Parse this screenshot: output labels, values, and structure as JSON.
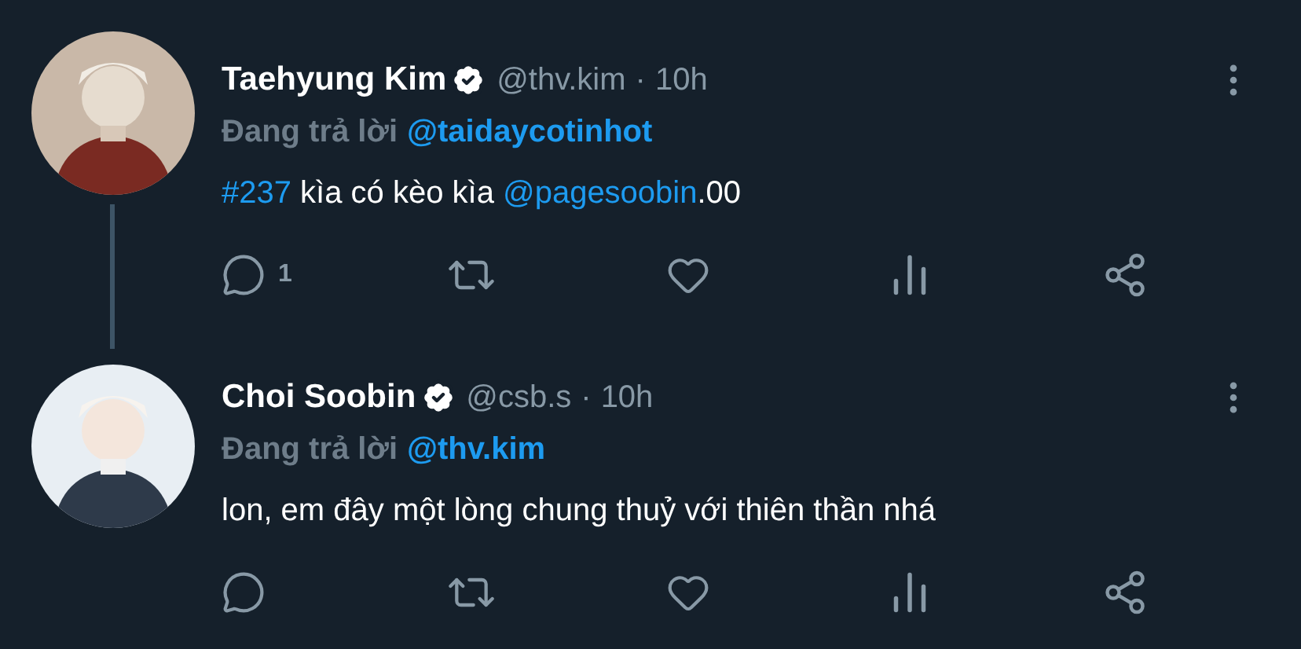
{
  "tweets": [
    {
      "name": "Taehyung Kim",
      "verified": true,
      "handle": "@thv.kim",
      "separator": "·",
      "time": "10h",
      "reply_label": "Đang trả lời",
      "reply_to": "@taidaycotinhot",
      "thread_line": true,
      "body": [
        {
          "kind": "hashtag",
          "text": "#237"
        },
        {
          "kind": "text",
          "text": " kìa có kèo kìa "
        },
        {
          "kind": "mention",
          "text": "@pagesoobin"
        },
        {
          "kind": "text",
          "text": ".00"
        }
      ],
      "reply_count": "1"
    },
    {
      "name": "Choi Soobin",
      "verified": true,
      "handle": "@csb.s",
      "separator": "·",
      "time": "10h",
      "reply_label": "Đang trả lời",
      "reply_to": "@thv.kim",
      "thread_line": false,
      "body": [
        {
          "kind": "text",
          "text": "lon, em đây một lòng chung thuỷ với thiên thần nhá"
        }
      ]
    }
  ]
}
